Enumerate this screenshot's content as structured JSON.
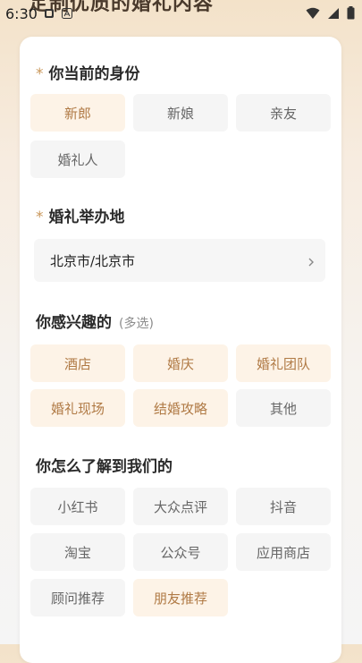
{
  "status": {
    "time": "6:30"
  },
  "header": {
    "title": "定制优质的婚礼内容"
  },
  "identity": {
    "title": "你当前的身份",
    "options": [
      "新郎",
      "新娘",
      "亲友",
      "婚礼人"
    ],
    "selected": "新郎"
  },
  "venue": {
    "title": "婚礼举办地",
    "value": "北京市/北京市"
  },
  "interests": {
    "title": "你感兴趣的",
    "hint": "(多选)",
    "options": [
      "酒店",
      "婚庆",
      "婚礼团队",
      "婚礼现场",
      "结婚攻略",
      "其他"
    ],
    "selected": [
      "酒店",
      "婚庆",
      "婚礼团队",
      "婚礼现场",
      "结婚攻略"
    ]
  },
  "source": {
    "title": "你怎么了解到我们的",
    "options": [
      "小红书",
      "大众点评",
      "抖音",
      "淘宝",
      "公众号",
      "应用商店",
      "顾问推荐",
      "朋友推荐"
    ],
    "selected": "朋友推荐"
  },
  "colors": {
    "accent": "#c9975a",
    "chip_selected_bg": "#fdf3e7",
    "chip_bg": "#f5f5f5"
  }
}
